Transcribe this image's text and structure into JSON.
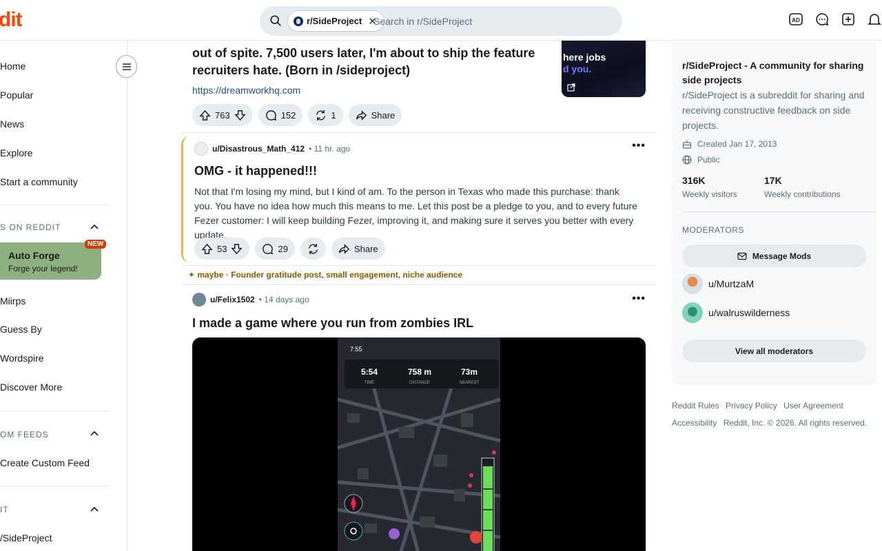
{
  "topbar": {
    "logo": "dit",
    "chip_label": "r/SideProject",
    "search_placeholder": "Search in r/SideProject"
  },
  "sidebar": {
    "items": [
      "Home",
      "Popular",
      "News",
      "Explore",
      "Start a community"
    ],
    "section_games": "S ON REDDIT",
    "promo_title": "Auto Forge",
    "promo_sub": "Forge your legend!",
    "promo_badge": "NEW",
    "games": [
      "Miirps",
      "Guess By",
      "Wordspire",
      "Discover More"
    ],
    "section_feeds": "OM FEEDS",
    "feeds": [
      "Create Custom Feed"
    ],
    "section_recent": "IT",
    "recent": [
      "/SideProject"
    ]
  },
  "post1": {
    "title": "out of spite. 7,500 users later, I'm about to ship the feature recruiters hate. (Born in /sideproject)",
    "link": "https://dreamworkhq.com",
    "thumb_line1": "here jobs",
    "thumb_line2": "d you.",
    "votes": "763",
    "comments": "152",
    "crossposts": "1",
    "share": "Share"
  },
  "post2": {
    "user": "u/Disastrous_Math_412",
    "time": "11 hr. ago",
    "title": "OMG - it happened!!!",
    "body": "Not that I'm losing my mind, but I kind of am. To the person in Texas who made this purchase: thank you. You have no idea how much this means to me. Let this post be a pledge to you, and to every future Fezer customer: I will keep building Fezer, improving it, and making sure it serves you better with every update.",
    "votes": "53",
    "comments": "29",
    "share": "Share"
  },
  "ai_note": "✦ maybe · Founder gratitude post, small engagement, niche audience",
  "post3": {
    "user": "u/Felix1502",
    "time": "14 days ago",
    "title": "I made a game where you run from zombies IRL",
    "status_time": "7:55",
    "hud": [
      {
        "value": "5:54",
        "label": "TIME"
      },
      {
        "value": "758 m",
        "label": "DISTANCE"
      },
      {
        "value": "73m",
        "label": "NEAREST"
      }
    ]
  },
  "community": {
    "title": "r/SideProject - A community for sharing side projects",
    "description": "r/SideProject is a subreddit for sharing and receiving constructive feedback on side projects.",
    "created": "Created Jan 17, 2013",
    "visibility": "Public",
    "visitors": "316K",
    "visitors_label": "Weekly visitors",
    "contributions": "17K",
    "contributions_label": "Weekly contributions",
    "moderators_heading": "MODERATORS",
    "message_mods": "Message Mods",
    "mods": [
      "u/MurtzaM",
      "u/walruswilderness"
    ],
    "view_all": "View all moderators"
  },
  "footer": {
    "links": [
      "Reddit Rules",
      "Privacy Policy",
      "User Agreement",
      "Accessibility"
    ],
    "copyright": "Reddit, Inc. © 2026. All rights reserved."
  },
  "colors": {
    "brand": "#ff4500",
    "pill_bg": "#e5ebee",
    "accent_border": "#f2b34d"
  }
}
